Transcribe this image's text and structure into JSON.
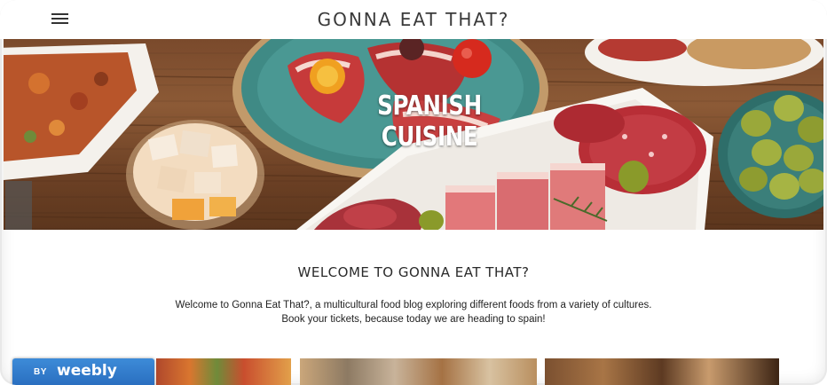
{
  "header": {
    "site_title": "GONNA EAT THAT?",
    "menu_icon": "hamburger-menu-icon"
  },
  "hero": {
    "heading": "SPANISH CUISINE"
  },
  "welcome": {
    "heading": "WELCOME TO GONNA EAT THAT?",
    "line1": "Welcome to Gonna Eat That?, a multicultural food blog exploring different foods from a variety of cultures.",
    "line2": "Book your tickets, because today we are heading to spain!"
  },
  "badge": {
    "by_text": "BY",
    "brand": "weebly"
  },
  "colors": {
    "badge_blue": "#2a6fc0",
    "title_text": "#3a3a3a",
    "body_text": "#222222"
  }
}
